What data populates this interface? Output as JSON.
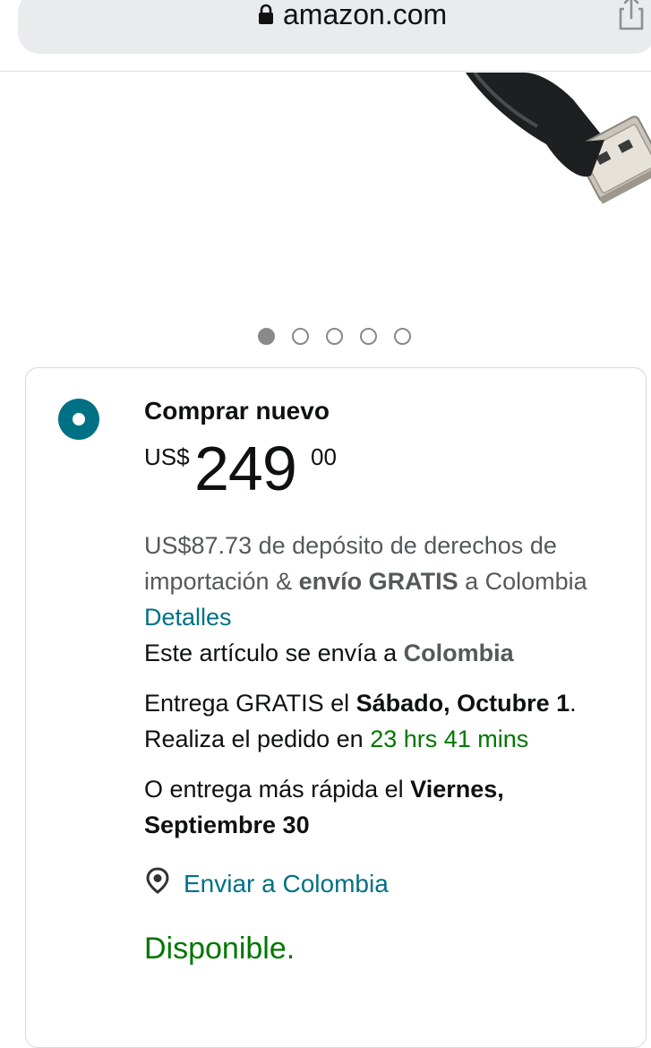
{
  "browser": {
    "url": "amazon.com",
    "icons": {
      "lock": "lock-icon",
      "share": "share-icon"
    }
  },
  "carousel": {
    "total_images": 5,
    "active_index": 0
  },
  "offer": {
    "option_title": "Comprar nuevo",
    "price": {
      "currency": "US$",
      "whole": "249",
      "fraction": "00"
    },
    "import_fee": "US$87.73 de depósito de derechos de importación & ",
    "free_shipping": "envío GRATIS",
    "to_country_prefix": " a Colombia ",
    "details_link": "Detalles",
    "ships_to_prefix": "Este artículo se envía a ",
    "ships_to_country": "Colombia",
    "delivery_prefix": "Entrega GRATIS el ",
    "delivery_date": "Sábado, Octubre 1",
    "order_within_prefix": ". Realiza el pedido en ",
    "order_within_time": "23 hrs 41 mins",
    "fast_prefix": "O entrega más rápida el ",
    "fast_date": "Viernes, Septiembre 30",
    "ship_to_link": "Enviar a Colombia",
    "availability": "Disponible."
  },
  "colors": {
    "accent": "#007185",
    "success": "#007600",
    "muted_text": "#565959"
  }
}
